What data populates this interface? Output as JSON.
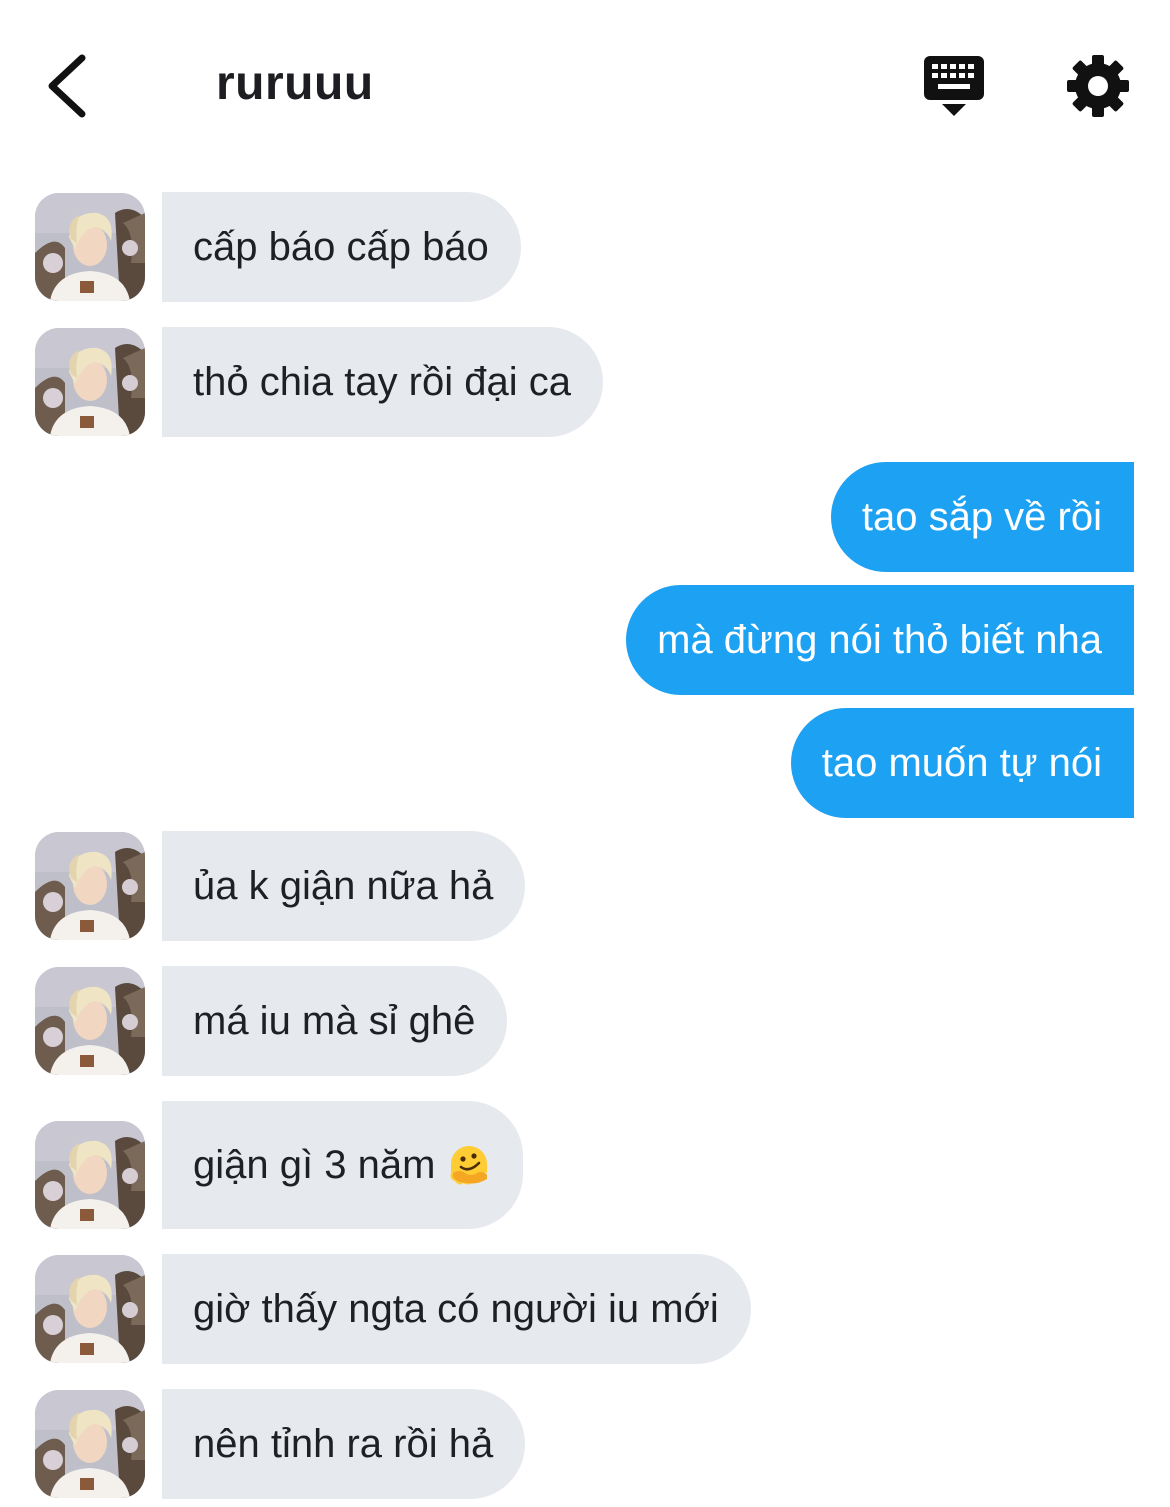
{
  "header": {
    "title": "ruruuu",
    "back_icon": "chevron-left-icon",
    "keyboard_icon": "keyboard-icon",
    "settings_icon": "gear-icon"
  },
  "colors": {
    "outgoing_bubble": "#1da1f2",
    "incoming_bubble": "#e6e9ee"
  },
  "messages": [
    {
      "side": "in",
      "text": "cấp báo cấp báo"
    },
    {
      "side": "in",
      "text": "thỏ chia tay rồi đại ca"
    },
    {
      "side": "out",
      "text": "tao sắp về rồi"
    },
    {
      "side": "out",
      "text": "mà đừng nói thỏ biết nha"
    },
    {
      "side": "out",
      "text": "tao muốn tự nói"
    },
    {
      "side": "in",
      "text": "ủa k giận nữa hả"
    },
    {
      "side": "in",
      "text": "má iu mà sỉ ghê"
    },
    {
      "side": "in",
      "text": "giận gì 3 năm",
      "emoji": "melting-face-emoji"
    },
    {
      "side": "in",
      "text": "giờ thấy ngta có người iu mới"
    },
    {
      "side": "in",
      "text": "nên tỉnh ra rồi hả"
    }
  ]
}
